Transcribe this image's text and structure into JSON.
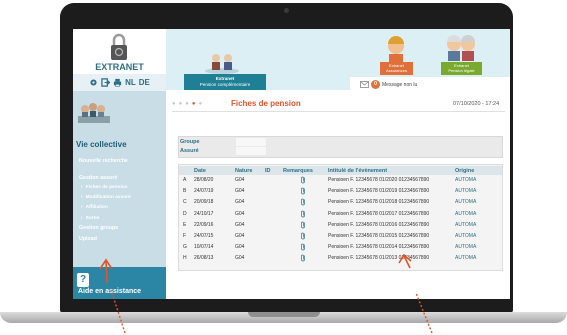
{
  "brand": {
    "name": "EXTRANET",
    "languages": [
      "NL",
      "DE"
    ]
  },
  "sidebar": {
    "section_title": "Vie collective",
    "new_search": "Nouvelle recherche",
    "heading_assure": "Gestion assuré",
    "sub_items": [
      "Fiches de pension",
      "Modification assuré",
      "Affiliation",
      "Sortie"
    ],
    "groups": "Gestion groups",
    "upload": "Upload",
    "help_label": "Aide en assistance",
    "help_icon": "?"
  },
  "header": {
    "main_tab": {
      "line1": "Extranet",
      "line2": "Pension complémentaire"
    },
    "tab_assurances": {
      "line1": "Extranet",
      "line2": "Assurances"
    },
    "tab_pension": {
      "line1": "Extranet",
      "line2": "Pension légale"
    },
    "messages": {
      "count": "0",
      "label": "Message non lu"
    }
  },
  "page": {
    "title": "Fiches de pension",
    "datetime": "07/10/2020 - 17:24",
    "step_dots": 5,
    "active_step": 4
  },
  "info": {
    "groupe_label": "Groupe",
    "assure_label": "Assuré"
  },
  "table": {
    "columns": {
      "date": "Date",
      "nature": "Nature",
      "id": "ID",
      "remarques": "Remarques",
      "intitule": "Intitulé de l'évènement",
      "origine": "Origine"
    },
    "rows": [
      {
        "letter": "A",
        "date": "28/08/20",
        "nature": "G04",
        "intitule": "Pensioen F. 12345678 01/2020 01234567890",
        "origine": "AUTOMA"
      },
      {
        "letter": "B",
        "date": "24/07/19",
        "nature": "G04",
        "intitule": "Pensioen F. 12345678 01/2019 01234567890",
        "origine": "AUTOMA"
      },
      {
        "letter": "C",
        "date": "20/09/18",
        "nature": "G04",
        "intitule": "Pensioen F. 12345678 01/2018 01234567890",
        "origine": "AUTOMA"
      },
      {
        "letter": "D",
        "date": "24/10/17",
        "nature": "G04",
        "intitule": "Pensioen F. 12345678 01/2017 01234567890",
        "origine": "AUTOMA"
      },
      {
        "letter": "E",
        "date": "22/09/16",
        "nature": "G04",
        "intitule": "Pensioen F. 12345678 01/2016 01234567890",
        "origine": "AUTOMA"
      },
      {
        "letter": "F",
        "date": "24/07/15",
        "nature": "G04",
        "intitule": "Pensioen F. 12345678 01/2015 01234567890",
        "origine": "AUTOMA"
      },
      {
        "letter": "G",
        "date": "10/07/14",
        "nature": "G04",
        "intitule": "Pensioen F. 12345678 01/2014 01234567890",
        "origine": "AUTOMA"
      },
      {
        "letter": "H",
        "date": "26/08/13",
        "nature": "G04",
        "intitule": "Pensioen F. 12345678 01/2013 01234567890",
        "origine": "AUTOMA"
      }
    ]
  },
  "colors": {
    "accent": "#e0552b",
    "teal": "#2b6f86",
    "sidebar": "#c8dde6",
    "assurances": "#e07039",
    "pension": "#79aa2e"
  }
}
